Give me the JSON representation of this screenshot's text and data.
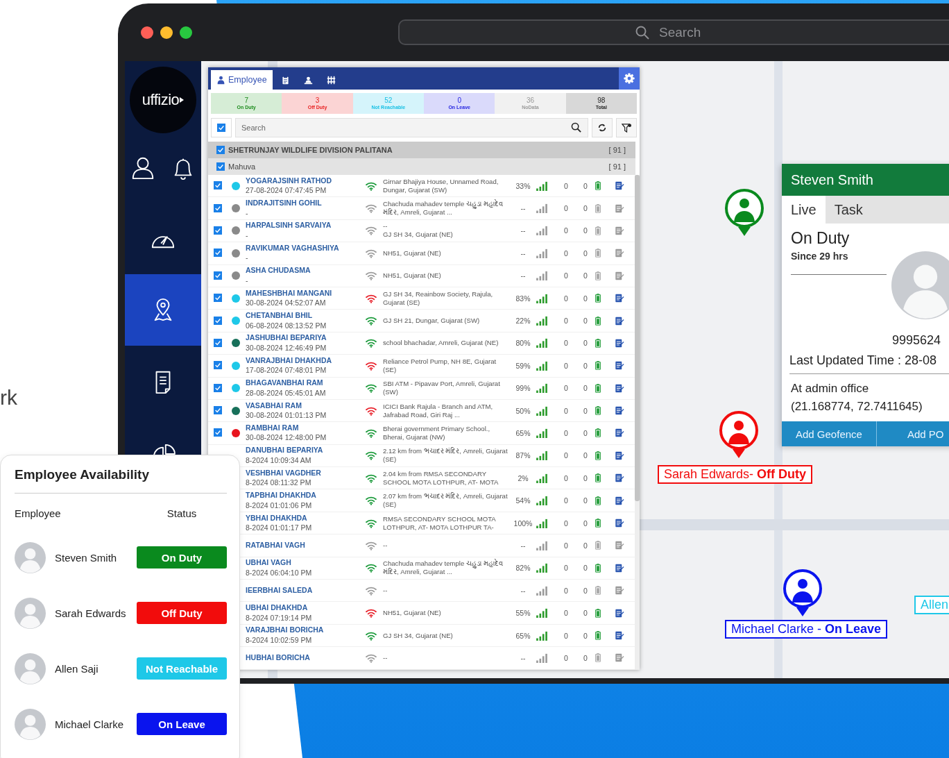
{
  "page": {
    "side_text": "rk"
  },
  "browser": {
    "search": {
      "placeholder": "Search"
    }
  },
  "sidebar": {
    "logo": "uffizio",
    "items": [
      {
        "selected": false
      },
      {
        "selected": true
      },
      {
        "selected": false
      },
      {
        "selected": false
      }
    ]
  },
  "employee_panel": {
    "tabs": [
      {
        "label": "Employee",
        "selected": true
      },
      {
        "selected": false
      },
      {
        "selected": false
      },
      {
        "selected": false
      }
    ],
    "summary": [
      {
        "count": "7",
        "label": "On Duty",
        "kind": "on_duty"
      },
      {
        "count": "3",
        "label": "Off Duty",
        "kind": "off_duty"
      },
      {
        "count": "52",
        "label": "Not Reachable",
        "kind": "not_reachable"
      },
      {
        "count": "0",
        "label": "On Leave",
        "kind": "on_leave"
      },
      {
        "count": "36",
        "label": "NoData",
        "kind": "no_data"
      },
      {
        "count": "98",
        "label": "Total",
        "kind": "total"
      }
    ],
    "search": {
      "placeholder": "Search",
      "checked": true
    },
    "groups": [
      {
        "name": "SHETRUNJAY WILDLIFE DIVISION PALITANA",
        "count": "[ 91 ]",
        "checked": true
      },
      {
        "name": "Mahuva",
        "count": "[ 91 ]",
        "checked": true
      }
    ],
    "rows": [
      {
        "checked": true,
        "color": "#1ec8e8",
        "name": "YOGARAJSINH RATHOD",
        "time": "27-08-2024 07:47:45 PM",
        "wifi": {
          "color": "#1a9a3a"
        },
        "address": [
          "Girnar Bhajiya House, Unnamed Road, Dungar, Gujarat (SW)"
        ],
        "battery": "33%",
        "online": true,
        "col_a": "0",
        "col_b": "0"
      },
      {
        "checked": true,
        "color": "#8a8a8a",
        "name": "INDRAJITSINH GOHIL",
        "time": "-",
        "wifi": {
          "color": "#9a9a9a"
        },
        "address": [
          "Chachuda mahadev temple ચહુડા મહાદેવ મંદિર, Amreli, Gujarat ..."
        ],
        "battery": "--",
        "online": false,
        "col_a": "0",
        "col_b": "0"
      },
      {
        "checked": true,
        "color": "#8a8a8a",
        "name": "HARPALSINH SARVAIYA",
        "time": "-",
        "wifi": {
          "color": "#9a9a9a"
        },
        "address": [
          "--",
          "GJ SH 34, Gujarat (NE)"
        ],
        "battery": "--",
        "online": false,
        "col_a": "0",
        "col_b": "0"
      },
      {
        "checked": true,
        "color": "#8a8a8a",
        "name": "RAVIKUMAR VAGHASHIYA",
        "time": "-",
        "wifi": {
          "color": "#9a9a9a"
        },
        "address": [
          "NH51, Gujarat (NE)"
        ],
        "battery": "--",
        "online": false,
        "col_a": "0",
        "col_b": "0"
      },
      {
        "checked": true,
        "color": "#8a8a8a",
        "name": "ASHA CHUDASMA",
        "time": "-",
        "wifi": {
          "color": "#9a9a9a"
        },
        "address": [
          "NH51, Gujarat (NE)"
        ],
        "battery": "--",
        "online": false,
        "col_a": "0",
        "col_b": "0"
      },
      {
        "checked": true,
        "color": "#1ec8e8",
        "name": "MAHESHBHAI MANGANI",
        "time": "30-08-2024 04:52:07 AM",
        "wifi": {
          "color": "#e8202a"
        },
        "address": [
          "GJ SH 34, Reainbow Society, Rajula, Gujarat (SE)"
        ],
        "battery": "83%",
        "online": true,
        "col_a": "0",
        "col_b": "0"
      },
      {
        "checked": true,
        "color": "#1ec8e8",
        "name": "CHETANBHAI BHIL",
        "time": "06-08-2024 08:13:52 PM",
        "wifi": {
          "color": "#1a9a3a"
        },
        "address": [
          "GJ SH 21, Dungar, Gujarat (SW)"
        ],
        "battery": "22%",
        "online": true,
        "col_a": "0",
        "col_b": "0"
      },
      {
        "checked": true,
        "color": "#17705a",
        "name": "JASHUBHAI BEPARIYA",
        "time": "30-08-2024 12:46:49 PM",
        "wifi": {
          "color": "#1a9a3a"
        },
        "address": [
          "school bhachadar, Amreli, Gujarat (NE)"
        ],
        "battery": "80%",
        "online": true,
        "col_a": "0",
        "col_b": "0"
      },
      {
        "checked": true,
        "color": "#1ec8e8",
        "name": "VANRAJBHAI DHAKHDA",
        "time": "17-08-2024 07:48:01 PM",
        "wifi": {
          "color": "#e8202a"
        },
        "address": [
          "Reliance Petrol Pump, NH 8E, Gujarat (SE)"
        ],
        "battery": "59%",
        "online": true,
        "col_a": "0",
        "col_b": "0"
      },
      {
        "checked": true,
        "color": "#1ec8e8",
        "name": "BHAGAVANBHAI RAM",
        "time": "28-08-2024 05:45:01 AM",
        "wifi": {
          "color": "#1a9a3a"
        },
        "address": [
          "SBI ATM - Pipavav Port, Amreli, Gujarat (SW)"
        ],
        "battery": "99%",
        "online": true,
        "col_a": "0",
        "col_b": "0"
      },
      {
        "checked": true,
        "color": "#17705a",
        "name": "VASABHAI RAM",
        "time": "30-08-2024 01:01:13 PM",
        "wifi": {
          "color": "#e8202a"
        },
        "address": [
          "ICICI Bank Rajula - Branch and ATM, Jafrabad Road, Giri Raj ..."
        ],
        "battery": "50%",
        "online": true,
        "col_a": "0",
        "col_b": "0"
      },
      {
        "checked": true,
        "color": "#e8141e",
        "name": "RAMBHAI RAM",
        "time": "30-08-2024 12:48:00 PM",
        "wifi": {
          "color": "#1a9a3a"
        },
        "address": [
          "Bherai government Primary School., Bherai, Gujarat (NW)"
        ],
        "battery": "65%",
        "online": true,
        "col_a": "0",
        "col_b": "0"
      },
      {
        "name": "DANUBHAI BEPARIYA",
        "time": "8-2024 10:09:34 AM",
        "wifi": {
          "color": "#1a9a3a"
        },
        "address": [
          "2.12 km from ભચાદર મંદિર, Amreli, Gujarat (SE)"
        ],
        "battery": "87%",
        "online": true,
        "col_a": "0",
        "col_b": "0"
      },
      {
        "name": "VESHBHAI VAGDHER",
        "time": "8-2024 08:11:32 PM",
        "wifi": {
          "color": "#1a9a3a"
        },
        "address": [
          "2.04 km from RMSA SECONDARY SCHOOL MOTA LOTHPUR, AT- MOTA"
        ],
        "battery": "2%",
        "online": true,
        "col_a": "0",
        "col_b": "0"
      },
      {
        "name": "TAPBHAI DHAKHDA",
        "time": "8-2024 01:01:06 PM",
        "wifi": {
          "color": "#1a9a3a"
        },
        "address": [
          "2.07 km from ભચાદર મંદિર, Amreli, Gujarat (SE)"
        ],
        "battery": "54%",
        "online": true,
        "col_a": "0",
        "col_b": "0"
      },
      {
        "name": "YBHAI DHAKHDA",
        "time": "8-2024 01:01:17 PM",
        "wifi": {
          "color": "#1a9a3a"
        },
        "address": [
          "RMSA SECONDARY SCHOOL MOTA LOTHPUR, AT- MOTA LOTHPUR TA-"
        ],
        "battery": "100%",
        "online": true,
        "col_a": "0",
        "col_b": "0"
      },
      {
        "name": "RATABHAI VAGH",
        "wifi": {
          "color": "#9a9a9a"
        },
        "address": [
          "--"
        ],
        "battery": "--",
        "online": false,
        "col_a": "0",
        "col_b": "0"
      },
      {
        "name": "UBHAI VAGH",
        "time": "8-2024 06:04:10 PM",
        "wifi": {
          "color": "#1a9a3a"
        },
        "address": [
          "Chachuda mahadev temple ચહુડા મહાદેવ મંદિર, Amreli, Gujarat ..."
        ],
        "battery": "82%",
        "online": true,
        "col_a": "0",
        "col_b": "0"
      },
      {
        "name": "IEERBHAI SALEDA",
        "wifi": {
          "color": "#9a9a9a"
        },
        "address": [
          "--"
        ],
        "battery": "--",
        "online": false,
        "col_a": "0",
        "col_b": "0"
      },
      {
        "name": "UBHAI DHAKHDA",
        "time": "8-2024 07:19:14 PM",
        "wifi": {
          "color": "#e8202a"
        },
        "address": [
          "NH51, Gujarat (NE)"
        ],
        "battery": "55%",
        "online": true,
        "col_a": "0",
        "col_b": "0"
      },
      {
        "name": "VARAJBHAI BORICHA",
        "time": "8-2024 10:02:59 PM",
        "wifi": {
          "color": "#1a9a3a"
        },
        "address": [
          "GJ SH 34, Gujarat (NE)"
        ],
        "battery": "65%",
        "online": true,
        "col_a": "0",
        "col_b": "0"
      },
      {
        "name": "HUBHAI BORICHA",
        "wifi": {
          "color": "#9a9a9a"
        },
        "address": [
          "--"
        ],
        "battery": "--",
        "online": false,
        "col_a": "0",
        "col_b": "0"
      }
    ]
  },
  "popup": {
    "name": "Steven Smith",
    "tabs": [
      {
        "label": "Live",
        "selected": true
      },
      {
        "label": "Task",
        "selected": false
      }
    ],
    "status": "On Duty",
    "since": "Since 29 hrs",
    "phone": "9995624",
    "last_updated": "Last Updated Time : 28-08",
    "location": "At admin office",
    "coords": "(21.168774, 72.7411645)",
    "buttons": [
      "Add Geofence",
      "Add PO"
    ]
  },
  "map": {
    "markers": [
      {
        "kind": "on_duty"
      },
      {
        "kind": "off_duty",
        "label": "Sarah Edwards- **Off Duty**"
      },
      {
        "kind": "on_leave",
        "label": "Michael Clarke - **On Leave**"
      }
    ],
    "edge_labels": [
      {
        "kind": "not_reachable",
        "label": "Allen"
      }
    ]
  },
  "availability": {
    "title": "Employee Availability",
    "columns": [
      "Employee",
      "Status"
    ],
    "rows": [
      {
        "name": "Steven Smith",
        "status": "On Duty",
        "kind": "on_duty"
      },
      {
        "name": "Sarah Edwards",
        "status": "Off Duty",
        "kind": "off_duty"
      },
      {
        "name": "Allen Saji",
        "status": "Not Reachable",
        "kind": "not_reachable"
      },
      {
        "name": "Michael Clarke",
        "status": "On Leave",
        "kind": "on_leave"
      }
    ]
  }
}
